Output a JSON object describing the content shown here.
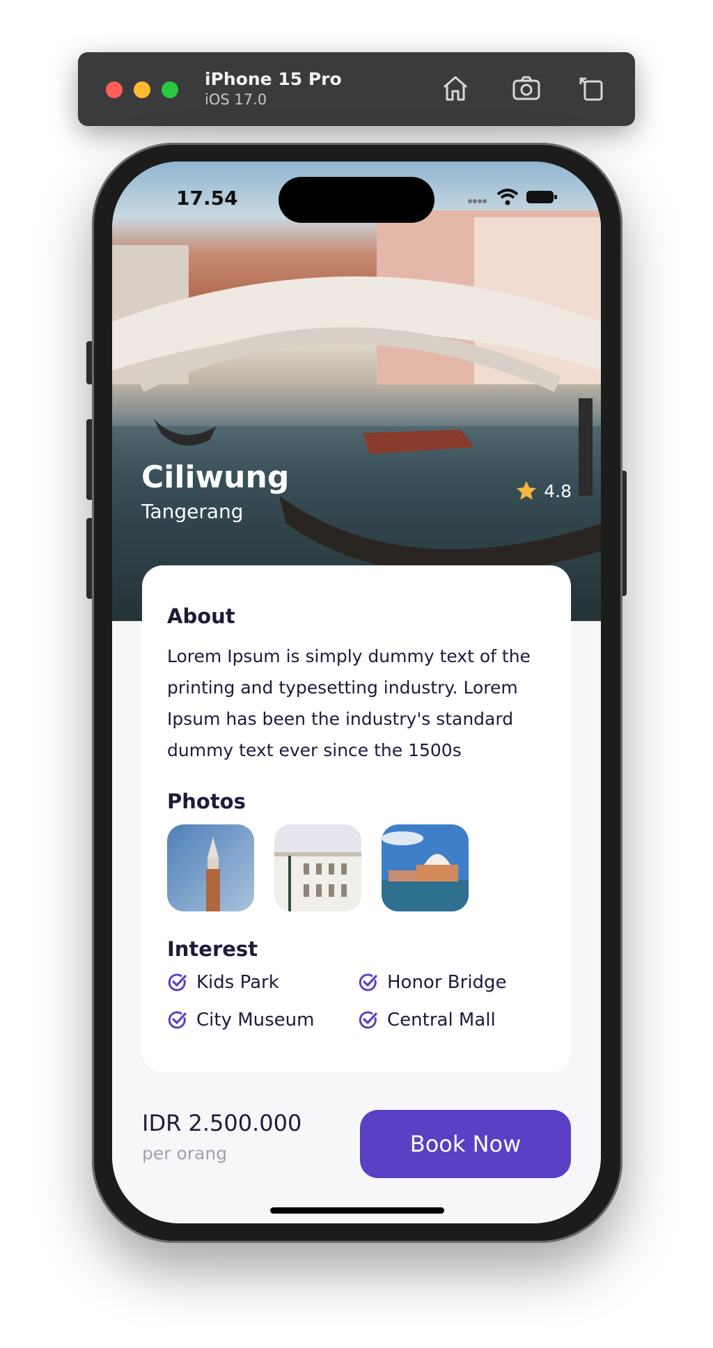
{
  "simulator": {
    "device": "iPhone 15 Pro",
    "os": "iOS 17.0",
    "icons": [
      "home-icon",
      "screenshot-icon",
      "rotate-icon"
    ]
  },
  "status_bar": {
    "time": "17.54"
  },
  "hero": {
    "title": "Ciliwung",
    "subtitle": "Tangerang",
    "rating": "4.8"
  },
  "about": {
    "title": "About",
    "text": "Lorem Ipsum is simply dummy text of the printing and typesetting industry. Lorem Ipsum has been the industry's standard dummy text ever since the 1500s"
  },
  "photos": {
    "title": "Photos"
  },
  "interest": {
    "title": "Interest",
    "items": [
      "Kids Park",
      "Honor Bridge",
      "City Museum",
      "Central Mall"
    ]
  },
  "footer": {
    "price": "IDR 2.500.000",
    "per": "per orang",
    "cta": "Book Now"
  },
  "colors": {
    "accent": "#5b3fc4",
    "text": "#1e1a3a",
    "star": "#f4b63f"
  }
}
